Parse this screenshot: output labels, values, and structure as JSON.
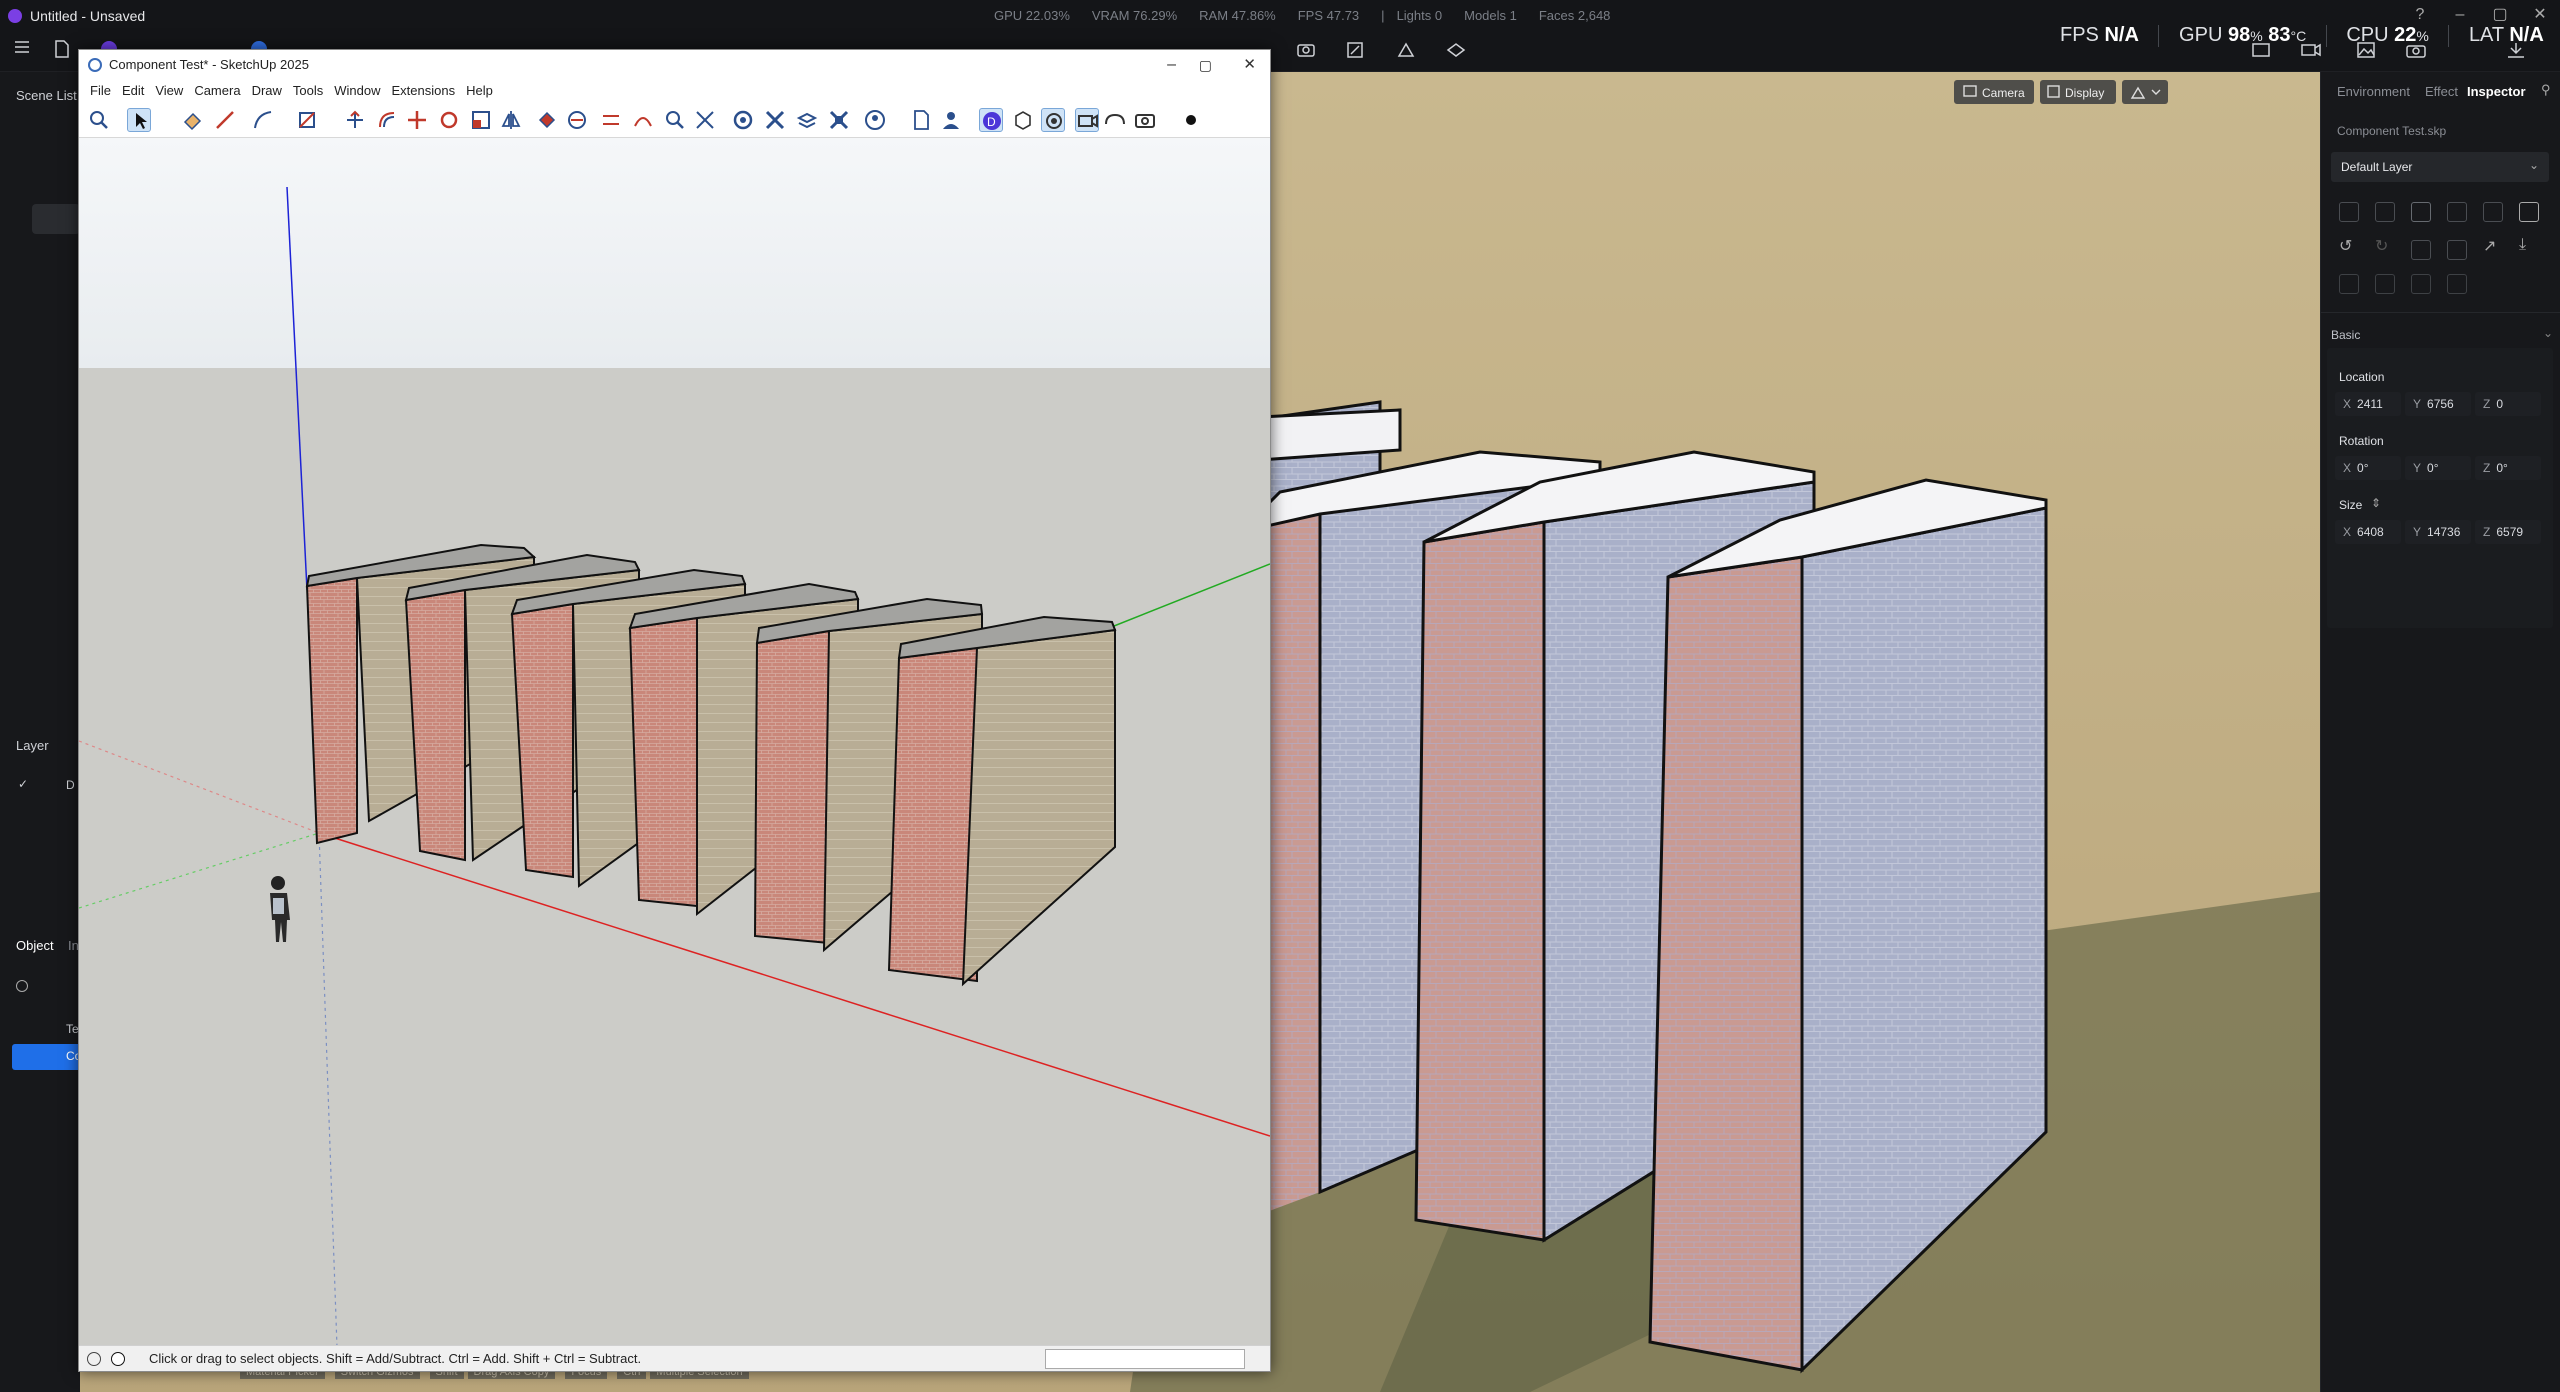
{
  "app": {
    "title": "Untitled - Unsaved",
    "stats": [
      "GPU 22.03%",
      "VRAM 76.29%",
      "RAM 47.86%",
      "FPS 47.73",
      "|",
      "Lights 0",
      "Models 1",
      "Faces 2,648"
    ],
    "perf": {
      "fps_label": "FPS",
      "fps_value": "N/A",
      "gpu_label": "GPU",
      "gpu_value": "98",
      "gpu_unit": "%",
      "gpu_temp": "83",
      "gpu_temp_unit": "°C",
      "cpu_label": "CPU",
      "cpu_value": "22",
      "cpu_unit": "%",
      "lat_label": "LAT",
      "lat_value": "N/A"
    }
  },
  "left_panel": {
    "scene_list_label": "Scene List",
    "layer_label": "Layer",
    "layer_item": "D",
    "object_tab": "Object",
    "other_tab": "In",
    "tree_items": [
      "Te",
      "Co"
    ]
  },
  "viewport_buttons": {
    "camera": "Camera",
    "display": "Display"
  },
  "inspector": {
    "tabs": [
      "Environment",
      "Effect",
      "Inspector"
    ],
    "file_name": "Component Test.skp",
    "layer_select": "Default Layer",
    "section": "Basic",
    "location_label": "Location",
    "location": {
      "x": "2411",
      "y": "6756",
      "z": "0"
    },
    "rotation_label": "Rotation",
    "rotation": {
      "x": "0°",
      "y": "0°",
      "z": "0°"
    },
    "size_label": "Size",
    "size": {
      "x": "6408",
      "y": "14736",
      "z": "6579"
    }
  },
  "sketchup": {
    "title": "Component Test* - SketchUp 2025",
    "menu": [
      "File",
      "Edit",
      "View",
      "Camera",
      "Draw",
      "Tools",
      "Window",
      "Extensions",
      "Help"
    ],
    "status_text": "Click or drag to select objects. Shift = Add/Subtract. Ctrl = Add. Shift + Ctrl = Subtract."
  },
  "bottom_hints": [
    "Material Picker",
    "Switch Gizmos",
    "Shift",
    "Drag Axis Copy",
    "Focus",
    "Ctrl",
    "Multiple Selection"
  ],
  "colors": {
    "accent": "#2f7bf5",
    "brick": "#c98c7a",
    "wall_side": "#b6ab92",
    "ground": "#b7a57e"
  }
}
